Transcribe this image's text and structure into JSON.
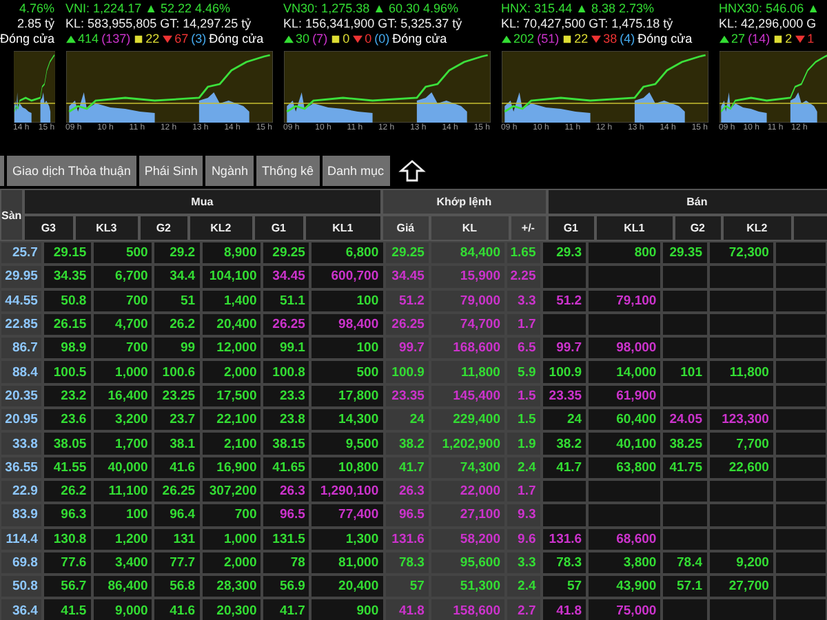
{
  "indices": [
    {
      "title": "4.76%",
      "volume": "2.85 tỷ",
      "stats": [
        {
          "kind": "status",
          "text": "Đóng cửa",
          "color": "#ffffff"
        }
      ],
      "times": [
        "14 h",
        "15 h"
      ]
    },
    {
      "title": "VNI: 1,224.17 ▲ 52.22 4.46%",
      "volume": "KL: 583,955,805 GT: 14,297.25 tỷ",
      "stats": [
        {
          "kind": "up",
          "text": "414",
          "color": "#33dd33"
        },
        {
          "kind": "ceiling",
          "text": "(137)",
          "color": "#cc33cc"
        },
        {
          "kind": "same",
          "text": "22",
          "color": "#dddd33"
        },
        {
          "kind": "down",
          "text": "67",
          "color": "#ee3333"
        },
        {
          "kind": "floor",
          "text": "(3)",
          "color": "#44aaee"
        },
        {
          "kind": "status",
          "text": "Đóng cửa",
          "color": "#ffffff"
        }
      ],
      "times": [
        "09 h",
        "10 h",
        "11 h",
        "12 h",
        "13 h",
        "14 h",
        "15 h"
      ]
    },
    {
      "title": "VN30: 1,275.38 ▲ 60.30 4.96%",
      "volume": "KL: 156,341,900 GT: 5,325.37 tỷ",
      "stats": [
        {
          "kind": "up",
          "text": "30",
          "color": "#33dd33"
        },
        {
          "kind": "ceiling",
          "text": "(7)",
          "color": "#cc33cc"
        },
        {
          "kind": "same",
          "text": "0",
          "color": "#dddd33"
        },
        {
          "kind": "down",
          "text": "0",
          "color": "#ee3333"
        },
        {
          "kind": "floor",
          "text": "(0)",
          "color": "#44aaee"
        },
        {
          "kind": "status",
          "text": "Đóng cửa",
          "color": "#ffffff"
        }
      ],
      "times": [
        "09 h",
        "10 h",
        "11 h",
        "12 h",
        "13 h",
        "14 h",
        "15 h"
      ]
    },
    {
      "title": "HNX: 315.44 ▲ 8.38 2.73%",
      "volume": "KL: 70,427,500 GT: 1,475.18 tỷ",
      "stats": [
        {
          "kind": "up",
          "text": "202",
          "color": "#33dd33"
        },
        {
          "kind": "ceiling",
          "text": "(51)",
          "color": "#cc33cc"
        },
        {
          "kind": "same",
          "text": "22",
          "color": "#dddd33"
        },
        {
          "kind": "down",
          "text": "38",
          "color": "#ee3333"
        },
        {
          "kind": "floor",
          "text": "(4)",
          "color": "#44aaee"
        },
        {
          "kind": "status",
          "text": "Đóng cửa",
          "color": "#ffffff"
        }
      ],
      "times": [
        "09 h",
        "10 h",
        "11 h",
        "12 h",
        "13 h",
        "14 h",
        "15 h"
      ]
    },
    {
      "title": "HNX30: 546.06 ▲",
      "volume": "KL: 42,296,000 G",
      "stats": [
        {
          "kind": "up",
          "text": "27",
          "color": "#33dd33"
        },
        {
          "kind": "ceiling",
          "text": "(14)",
          "color": "#cc33cc"
        },
        {
          "kind": "same",
          "text": "2",
          "color": "#dddd33"
        },
        {
          "kind": "down",
          "text": "1",
          "color": "#ee3333"
        }
      ],
      "times": [
        "09 h",
        "10 h",
        "11 h",
        "12 h"
      ]
    }
  ],
  "tabs": [
    "Giao dịch Thỏa thuận",
    "Phái Sinh",
    "Ngành",
    "Thống kê",
    "Danh mục"
  ],
  "table": {
    "ref_heading": "Sàn",
    "groups": [
      "Mua",
      "Khớp lệnh",
      "Bán"
    ],
    "buy_columns": [
      "G3",
      "KL3",
      "G2",
      "KL2",
      "G1",
      "KL1"
    ],
    "match_columns": [
      "Giá",
      "KL",
      "+/-"
    ],
    "sell_columns": [
      "G1",
      "KL1",
      "G2",
      "KL2"
    ],
    "rows": [
      {
        "ref": "25.7",
        "buy": [
          {
            "text": "29.15",
            "color": "#33dd33"
          },
          {
            "text": "500",
            "color": "#33dd33"
          },
          {
            "text": "29.2",
            "color": "#33dd33"
          },
          {
            "text": "8,900",
            "color": "#33dd33"
          },
          {
            "text": "29.25",
            "color": "#33dd33"
          },
          {
            "text": "6,800",
            "color": "#33dd33"
          }
        ],
        "match": [
          {
            "text": "29.25",
            "color": "#33dd33"
          },
          {
            "text": "84,400",
            "color": "#33dd33"
          },
          {
            "text": "1.65",
            "color": "#33dd33"
          }
        ],
        "sell": [
          {
            "text": "29.3",
            "color": "#33dd33"
          },
          {
            "text": "800",
            "color": "#33dd33"
          },
          {
            "text": "29.35",
            "color": "#33dd33"
          },
          {
            "text": "72,300",
            "color": "#33dd33"
          }
        ]
      },
      {
        "ref": "29.95",
        "buy": [
          {
            "text": "34.35",
            "color": "#33dd33"
          },
          {
            "text": "6,700",
            "color": "#33dd33"
          },
          {
            "text": "34.4",
            "color": "#33dd33"
          },
          {
            "text": "104,100",
            "color": "#33dd33"
          },
          {
            "text": "34.45",
            "color": "#cc33cc"
          },
          {
            "text": "600,700",
            "color": "#cc33cc"
          }
        ],
        "match": [
          {
            "text": "34.45",
            "color": "#cc33cc"
          },
          {
            "text": "15,900",
            "color": "#cc33cc"
          },
          {
            "text": "2.25",
            "color": "#cc33cc"
          }
        ],
        "sell": []
      },
      {
        "ref": "44.55",
        "buy": [
          {
            "text": "50.8",
            "color": "#33dd33"
          },
          {
            "text": "700",
            "color": "#33dd33"
          },
          {
            "text": "51",
            "color": "#33dd33"
          },
          {
            "text": "1,400",
            "color": "#33dd33"
          },
          {
            "text": "51.1",
            "color": "#33dd33"
          },
          {
            "text": "100",
            "color": "#33dd33"
          }
        ],
        "match": [
          {
            "text": "51.2",
            "color": "#cc33cc"
          },
          {
            "text": "79,000",
            "color": "#cc33cc"
          },
          {
            "text": "3.3",
            "color": "#cc33cc"
          }
        ],
        "sell": [
          {
            "text": "51.2",
            "color": "#cc33cc"
          },
          {
            "text": "79,100",
            "color": "#cc33cc"
          }
        ]
      },
      {
        "ref": "22.85",
        "buy": [
          {
            "text": "26.15",
            "color": "#33dd33"
          },
          {
            "text": "4,700",
            "color": "#33dd33"
          },
          {
            "text": "26.2",
            "color": "#33dd33"
          },
          {
            "text": "20,400",
            "color": "#33dd33"
          },
          {
            "text": "26.25",
            "color": "#cc33cc"
          },
          {
            "text": "98,400",
            "color": "#cc33cc"
          }
        ],
        "match": [
          {
            "text": "26.25",
            "color": "#cc33cc"
          },
          {
            "text": "74,700",
            "color": "#cc33cc"
          },
          {
            "text": "1.7",
            "color": "#cc33cc"
          }
        ],
        "sell": []
      },
      {
        "ref": "86.7",
        "buy": [
          {
            "text": "98.9",
            "color": "#33dd33"
          },
          {
            "text": "700",
            "color": "#33dd33"
          },
          {
            "text": "99",
            "color": "#33dd33"
          },
          {
            "text": "12,000",
            "color": "#33dd33"
          },
          {
            "text": "99.1",
            "color": "#33dd33"
          },
          {
            "text": "100",
            "color": "#33dd33"
          }
        ],
        "match": [
          {
            "text": "99.7",
            "color": "#cc33cc"
          },
          {
            "text": "168,600",
            "color": "#cc33cc"
          },
          {
            "text": "6.5",
            "color": "#cc33cc"
          }
        ],
        "sell": [
          {
            "text": "99.7",
            "color": "#cc33cc"
          },
          {
            "text": "98,000",
            "color": "#cc33cc"
          }
        ]
      },
      {
        "ref": "88.4",
        "buy": [
          {
            "text": "100.5",
            "color": "#33dd33"
          },
          {
            "text": "1,000",
            "color": "#33dd33"
          },
          {
            "text": "100.6",
            "color": "#33dd33"
          },
          {
            "text": "2,000",
            "color": "#33dd33"
          },
          {
            "text": "100.8",
            "color": "#33dd33"
          },
          {
            "text": "500",
            "color": "#33dd33"
          }
        ],
        "match": [
          {
            "text": "100.9",
            "color": "#33dd33"
          },
          {
            "text": "11,800",
            "color": "#33dd33"
          },
          {
            "text": "5.9",
            "color": "#33dd33"
          }
        ],
        "sell": [
          {
            "text": "100.9",
            "color": "#33dd33"
          },
          {
            "text": "14,000",
            "color": "#33dd33"
          },
          {
            "text": "101",
            "color": "#33dd33"
          },
          {
            "text": "11,800",
            "color": "#33dd33"
          }
        ]
      },
      {
        "ref": "20.35",
        "buy": [
          {
            "text": "23.2",
            "color": "#33dd33"
          },
          {
            "text": "16,400",
            "color": "#33dd33"
          },
          {
            "text": "23.25",
            "color": "#33dd33"
          },
          {
            "text": "17,500",
            "color": "#33dd33"
          },
          {
            "text": "23.3",
            "color": "#33dd33"
          },
          {
            "text": "17,800",
            "color": "#33dd33"
          }
        ],
        "match": [
          {
            "text": "23.35",
            "color": "#cc33cc"
          },
          {
            "text": "145,400",
            "color": "#cc33cc"
          },
          {
            "text": "1.5",
            "color": "#cc33cc"
          }
        ],
        "sell": [
          {
            "text": "23.35",
            "color": "#cc33cc"
          },
          {
            "text": "61,900",
            "color": "#cc33cc"
          }
        ]
      },
      {
        "ref": "20.95",
        "buy": [
          {
            "text": "23.6",
            "color": "#33dd33"
          },
          {
            "text": "3,200",
            "color": "#33dd33"
          },
          {
            "text": "23.7",
            "color": "#33dd33"
          },
          {
            "text": "22,100",
            "color": "#33dd33"
          },
          {
            "text": "23.8",
            "color": "#33dd33"
          },
          {
            "text": "14,300",
            "color": "#33dd33"
          }
        ],
        "match": [
          {
            "text": "24",
            "color": "#33dd33"
          },
          {
            "text": "229,400",
            "color": "#33dd33"
          },
          {
            "text": "1.5",
            "color": "#33dd33"
          }
        ],
        "sell": [
          {
            "text": "24",
            "color": "#33dd33"
          },
          {
            "text": "60,400",
            "color": "#33dd33"
          },
          {
            "text": "24.05",
            "color": "#cc33cc"
          },
          {
            "text": "123,300",
            "color": "#cc33cc"
          }
        ]
      },
      {
        "ref": "33.8",
        "buy": [
          {
            "text": "38.05",
            "color": "#33dd33"
          },
          {
            "text": "1,700",
            "color": "#33dd33"
          },
          {
            "text": "38.1",
            "color": "#33dd33"
          },
          {
            "text": "2,100",
            "color": "#33dd33"
          },
          {
            "text": "38.15",
            "color": "#33dd33"
          },
          {
            "text": "9,500",
            "color": "#33dd33"
          }
        ],
        "match": [
          {
            "text": "38.2",
            "color": "#33dd33"
          },
          {
            "text": "1,202,900",
            "color": "#33dd33"
          },
          {
            "text": "1.9",
            "color": "#33dd33"
          }
        ],
        "sell": [
          {
            "text": "38.2",
            "color": "#33dd33"
          },
          {
            "text": "40,100",
            "color": "#33dd33"
          },
          {
            "text": "38.25",
            "color": "#33dd33"
          },
          {
            "text": "7,700",
            "color": "#33dd33"
          }
        ]
      },
      {
        "ref": "36.55",
        "buy": [
          {
            "text": "41.55",
            "color": "#33dd33"
          },
          {
            "text": "40,000",
            "color": "#33dd33"
          },
          {
            "text": "41.6",
            "color": "#33dd33"
          },
          {
            "text": "16,900",
            "color": "#33dd33"
          },
          {
            "text": "41.65",
            "color": "#33dd33"
          },
          {
            "text": "10,800",
            "color": "#33dd33"
          }
        ],
        "match": [
          {
            "text": "41.7",
            "color": "#33dd33"
          },
          {
            "text": "74,300",
            "color": "#33dd33"
          },
          {
            "text": "2.4",
            "color": "#33dd33"
          }
        ],
        "sell": [
          {
            "text": "41.7",
            "color": "#33dd33"
          },
          {
            "text": "63,800",
            "color": "#33dd33"
          },
          {
            "text": "41.75",
            "color": "#33dd33"
          },
          {
            "text": "22,600",
            "color": "#33dd33"
          }
        ]
      },
      {
        "ref": "22.9",
        "buy": [
          {
            "text": "26.2",
            "color": "#33dd33"
          },
          {
            "text": "11,100",
            "color": "#33dd33"
          },
          {
            "text": "26.25",
            "color": "#33dd33"
          },
          {
            "text": "307,200",
            "color": "#33dd33"
          },
          {
            "text": "26.3",
            "color": "#cc33cc"
          },
          {
            "text": "1,290,100",
            "color": "#cc33cc"
          }
        ],
        "match": [
          {
            "text": "26.3",
            "color": "#cc33cc"
          },
          {
            "text": "22,000",
            "color": "#cc33cc"
          },
          {
            "text": "1.7",
            "color": "#cc33cc"
          }
        ],
        "sell": []
      },
      {
        "ref": "83.9",
        "buy": [
          {
            "text": "96.3",
            "color": "#33dd33"
          },
          {
            "text": "100",
            "color": "#33dd33"
          },
          {
            "text": "96.4",
            "color": "#33dd33"
          },
          {
            "text": "700",
            "color": "#33dd33"
          },
          {
            "text": "96.5",
            "color": "#cc33cc"
          },
          {
            "text": "77,400",
            "color": "#cc33cc"
          }
        ],
        "match": [
          {
            "text": "96.5",
            "color": "#cc33cc"
          },
          {
            "text": "27,100",
            "color": "#cc33cc"
          },
          {
            "text": "9.3",
            "color": "#cc33cc"
          }
        ],
        "sell": []
      },
      {
        "ref": "114.4",
        "buy": [
          {
            "text": "130.8",
            "color": "#33dd33"
          },
          {
            "text": "1,200",
            "color": "#33dd33"
          },
          {
            "text": "131",
            "color": "#33dd33"
          },
          {
            "text": "1,000",
            "color": "#33dd33"
          },
          {
            "text": "131.5",
            "color": "#33dd33"
          },
          {
            "text": "1,300",
            "color": "#33dd33"
          }
        ],
        "match": [
          {
            "text": "131.6",
            "color": "#cc33cc"
          },
          {
            "text": "58,200",
            "color": "#cc33cc"
          },
          {
            "text": "9.6",
            "color": "#cc33cc"
          }
        ],
        "sell": [
          {
            "text": "131.6",
            "color": "#cc33cc"
          },
          {
            "text": "68,600",
            "color": "#cc33cc"
          }
        ]
      },
      {
        "ref": "69.8",
        "buy": [
          {
            "text": "77.6",
            "color": "#33dd33"
          },
          {
            "text": "3,400",
            "color": "#33dd33"
          },
          {
            "text": "77.7",
            "color": "#33dd33"
          },
          {
            "text": "2,000",
            "color": "#33dd33"
          },
          {
            "text": "78",
            "color": "#33dd33"
          },
          {
            "text": "81,000",
            "color": "#33dd33"
          }
        ],
        "match": [
          {
            "text": "78.3",
            "color": "#33dd33"
          },
          {
            "text": "95,600",
            "color": "#33dd33"
          },
          {
            "text": "3.3",
            "color": "#33dd33"
          }
        ],
        "sell": [
          {
            "text": "78.3",
            "color": "#33dd33"
          },
          {
            "text": "3,800",
            "color": "#33dd33"
          },
          {
            "text": "78.4",
            "color": "#33dd33"
          },
          {
            "text": "9,200",
            "color": "#33dd33"
          }
        ]
      },
      {
        "ref": "50.8",
        "buy": [
          {
            "text": "56.7",
            "color": "#33dd33"
          },
          {
            "text": "86,400",
            "color": "#33dd33"
          },
          {
            "text": "56.8",
            "color": "#33dd33"
          },
          {
            "text": "28,300",
            "color": "#33dd33"
          },
          {
            "text": "56.9",
            "color": "#33dd33"
          },
          {
            "text": "20,400",
            "color": "#33dd33"
          }
        ],
        "match": [
          {
            "text": "57",
            "color": "#33dd33"
          },
          {
            "text": "51,300",
            "color": "#33dd33"
          },
          {
            "text": "2.4",
            "color": "#33dd33"
          }
        ],
        "sell": [
          {
            "text": "57",
            "color": "#33dd33"
          },
          {
            "text": "43,900",
            "color": "#33dd33"
          },
          {
            "text": "57.1",
            "color": "#33dd33"
          },
          {
            "text": "27,700",
            "color": "#33dd33"
          }
        ]
      },
      {
        "ref": "36.4",
        "buy": [
          {
            "text": "41.5",
            "color": "#33dd33"
          },
          {
            "text": "9,000",
            "color": "#33dd33"
          },
          {
            "text": "41.6",
            "color": "#33dd33"
          },
          {
            "text": "20,300",
            "color": "#33dd33"
          },
          {
            "text": "41.7",
            "color": "#33dd33"
          },
          {
            "text": "900",
            "color": "#33dd33"
          }
        ],
        "match": [
          {
            "text": "41.8",
            "color": "#cc33cc"
          },
          {
            "text": "158,600",
            "color": "#cc33cc"
          },
          {
            "text": "2.7",
            "color": "#cc33cc"
          }
        ],
        "sell": [
          {
            "text": "41.8",
            "color": "#cc33cc"
          },
          {
            "text": "75,000",
            "color": "#cc33cc"
          }
        ]
      }
    ]
  }
}
